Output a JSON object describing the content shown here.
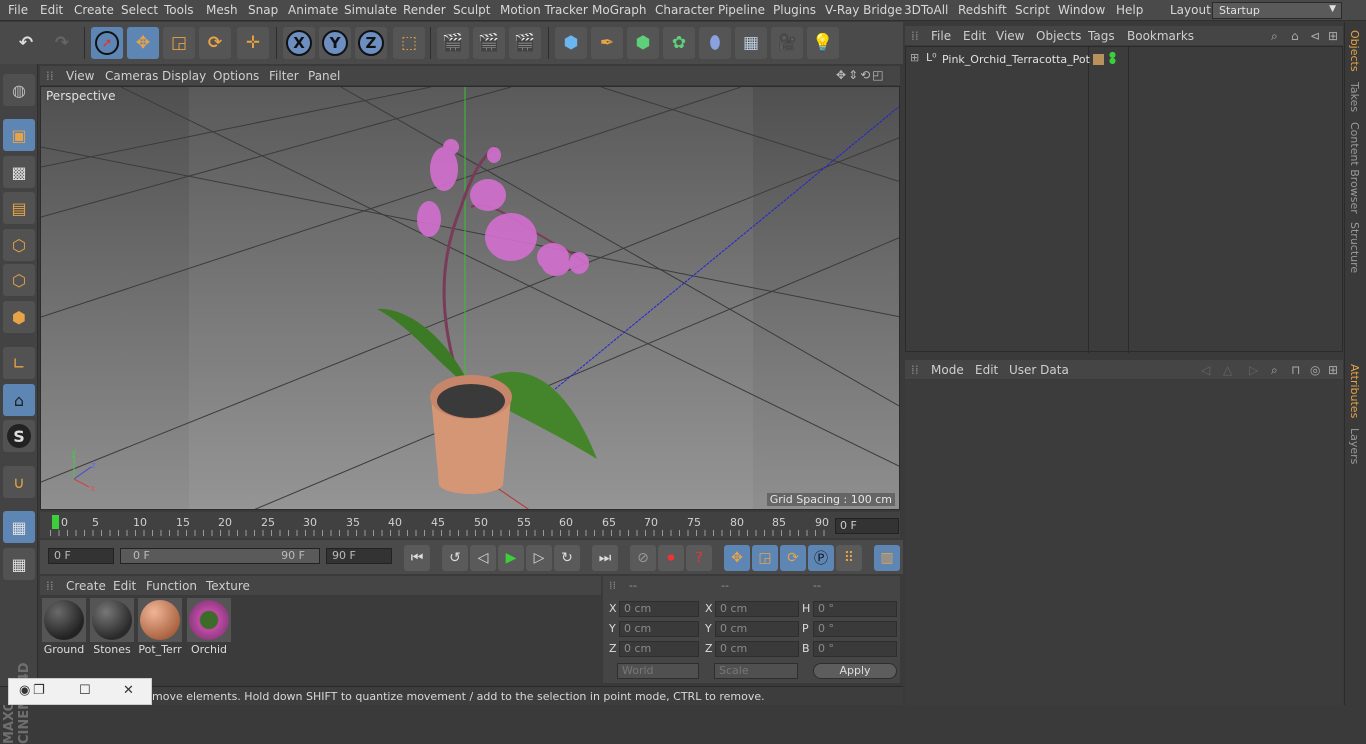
{
  "menu": [
    "File",
    "Edit",
    "Create",
    "Select",
    "Tools",
    "Mesh",
    "Snap",
    "Animate",
    "Simulate",
    "Render",
    "Sculpt",
    "Motion Tracker",
    "MoGraph",
    "Character",
    "Pipeline",
    "Plugins",
    "V-Ray Bridge",
    "3DToAll",
    "Redshift",
    "Script",
    "Window",
    "Help"
  ],
  "layout": {
    "label": "Layout:",
    "value": "Startup"
  },
  "toolbar": {
    "axis_x": "X",
    "axis_y": "Y",
    "axis_z": "Z"
  },
  "viewport": {
    "menu": [
      "View",
      "Cameras",
      "Display",
      "Options",
      "Filter",
      "Panel"
    ],
    "label": "Perspective",
    "grid_spacing": "Grid Spacing : 100 cm"
  },
  "timeline": {
    "ticks": [
      "0",
      "5",
      "10",
      "15",
      "20",
      "25",
      "30",
      "35",
      "40",
      "45",
      "50",
      "55",
      "60",
      "65",
      "70",
      "75",
      "80",
      "85",
      "90"
    ],
    "current_frame": "0 F",
    "start": "0 F",
    "range_start": "0 F",
    "range_end": "90 F",
    "end": "90 F"
  },
  "materials": {
    "menu": [
      "Create",
      "Edit",
      "Function",
      "Texture"
    ],
    "items": [
      "Ground",
      "Stones",
      "Pot_Terr",
      "Orchid"
    ]
  },
  "coords": {
    "headers": [
      "--",
      "--",
      "--"
    ],
    "pos": [
      {
        "axis": "X",
        "value": "0 cm"
      },
      {
        "axis": "Y",
        "value": "0 cm"
      },
      {
        "axis": "Z",
        "value": "0 cm"
      }
    ],
    "size": [
      {
        "axis": "X",
        "value": "0 cm"
      },
      {
        "axis": "Y",
        "value": "0 cm"
      },
      {
        "axis": "Z",
        "value": "0 cm"
      }
    ],
    "rot": [
      {
        "axis": "H",
        "value": "0 °"
      },
      {
        "axis": "P",
        "value": "0 °"
      },
      {
        "axis": "B",
        "value": "0 °"
      }
    ],
    "mode_world": "World",
    "mode_scale": "Scale",
    "apply": "Apply"
  },
  "status": "move elements. Hold down SHIFT to quantize movement / add to the selection in point mode, CTRL to remove.",
  "objects": {
    "menu": [
      "File",
      "Edit",
      "View",
      "Objects",
      "Tags",
      "Bookmarks"
    ],
    "name": "Pink_Orchid_Terracotta_Pot"
  },
  "attributes": {
    "menu": [
      "Mode",
      "Edit",
      "User Data"
    ]
  },
  "right_tabs": [
    "Objects",
    "Takes",
    "Content Browser",
    "Structure",
    "Attributes",
    "Layers"
  ],
  "logo": "MAXON CINEMA 4D"
}
